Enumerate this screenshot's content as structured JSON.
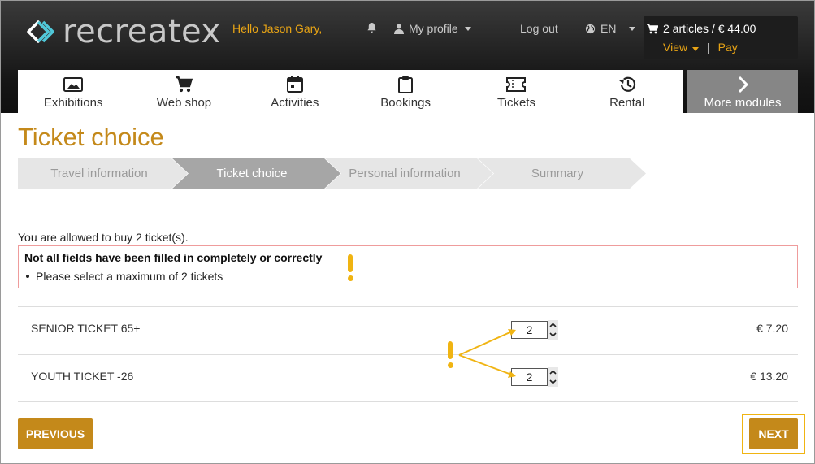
{
  "header": {
    "logo_text": "recreatex",
    "greeting": "Hello Jason Gary,",
    "my_profile": "My profile",
    "logout": "Log out",
    "language": "EN",
    "cart": {
      "summary": "2 articles / € 44.00",
      "view": "View",
      "separator": "|",
      "pay": "Pay"
    }
  },
  "modules": [
    {
      "label": "Exhibitions",
      "icon": "image-icon"
    },
    {
      "label": "Web shop",
      "icon": "cart-icon"
    },
    {
      "label": "Activities",
      "icon": "calendar-icon"
    },
    {
      "label": "Bookings",
      "icon": "clipboard-icon"
    },
    {
      "label": "Tickets",
      "icon": "ticket-icon"
    },
    {
      "label": "Rental",
      "icon": "history-icon"
    }
  ],
  "more_modules": "More modules",
  "page_title": "Ticket choice",
  "steps": [
    {
      "label": "Travel information",
      "active": false
    },
    {
      "label": "Ticket choice",
      "active": true
    },
    {
      "label": "Personal information",
      "active": false
    },
    {
      "label": "Summary",
      "active": false
    }
  ],
  "allowed_text": "You are allowed to buy 2 ticket(s).",
  "error": {
    "title": "Not all fields have been filled in completely or correctly",
    "items": [
      "Please select a maximum of 2 tickets"
    ]
  },
  "tickets": [
    {
      "name": "SENIOR TICKET 65+",
      "quantity": "2",
      "price": "€ 7.20"
    },
    {
      "name": "YOUTH TICKET -26",
      "quantity": "2",
      "price": "€ 13.20"
    }
  ],
  "buttons": {
    "previous": "PREVIOUS",
    "next": "NEXT"
  },
  "colors": {
    "accent": "#c4891a",
    "highlight": "#f0b412",
    "error_border": "#ef9c9c",
    "header_bg": "#1a1a1a",
    "greeting": "#e8a415"
  }
}
